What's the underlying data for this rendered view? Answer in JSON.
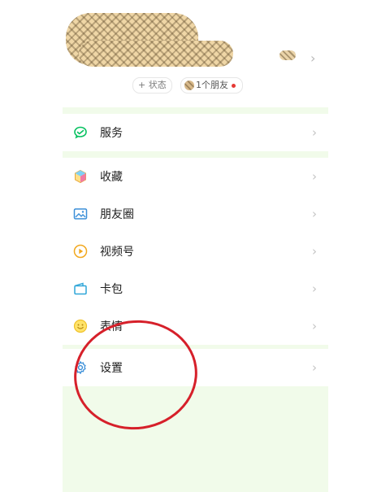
{
  "profile": {
    "status_label": "+ 状态",
    "friends_label": "1个朋友"
  },
  "menu": {
    "services": "服务",
    "favorites": "收藏",
    "moments": "朋友圈",
    "channels": "视频号",
    "cards": "卡包",
    "stickers": "表情",
    "settings": "设置"
  },
  "colors": {
    "accent_green": "#07c160",
    "section_bg": "#f1fbea",
    "annotation_red": "#d6202a"
  },
  "icons": {
    "services": "wechat-pay-icon",
    "favorites": "cube-icon",
    "moments": "image-icon",
    "channels": "play-icon",
    "cards": "wallet-icon",
    "stickers": "smiley-icon",
    "settings": "gear-icon"
  }
}
